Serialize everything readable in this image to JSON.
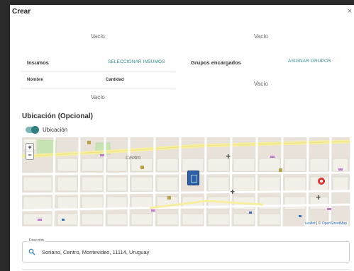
{
  "dialog": {
    "title": "Crear",
    "close": "×"
  },
  "top_left": {
    "empty": "Vacío"
  },
  "top_right": {
    "empty": "Vacío"
  },
  "insumos": {
    "label": "Insumos",
    "select_button": "SELECCIONAR INSUMOS",
    "columns": [
      "Nombre",
      "Cantidad"
    ],
    "empty": "Vacío"
  },
  "grupos": {
    "label": "Grupos encargados",
    "assign_button": "ASIGNAR GRUPOS",
    "empty": "Vacío"
  },
  "ubicacion": {
    "title": "Ubicación (Opcional)",
    "toggle_label": "Ubicación",
    "toggle_on": true
  },
  "map": {
    "zoom_in": "+",
    "zoom_out": "−",
    "place_label": "Centro",
    "attribution_prefix": "Leaflet",
    "attribution_sep": " | © ",
    "attribution_link": "OpenStreetMap"
  },
  "address": {
    "label": "Dirección",
    "value": "Soriano, Centro, Montevideo, 11114, Uruguay"
  },
  "colors": {
    "accent": "#2e8b8b",
    "marker": "#2f5fa8",
    "backdrop": "#2a2a2a"
  }
}
